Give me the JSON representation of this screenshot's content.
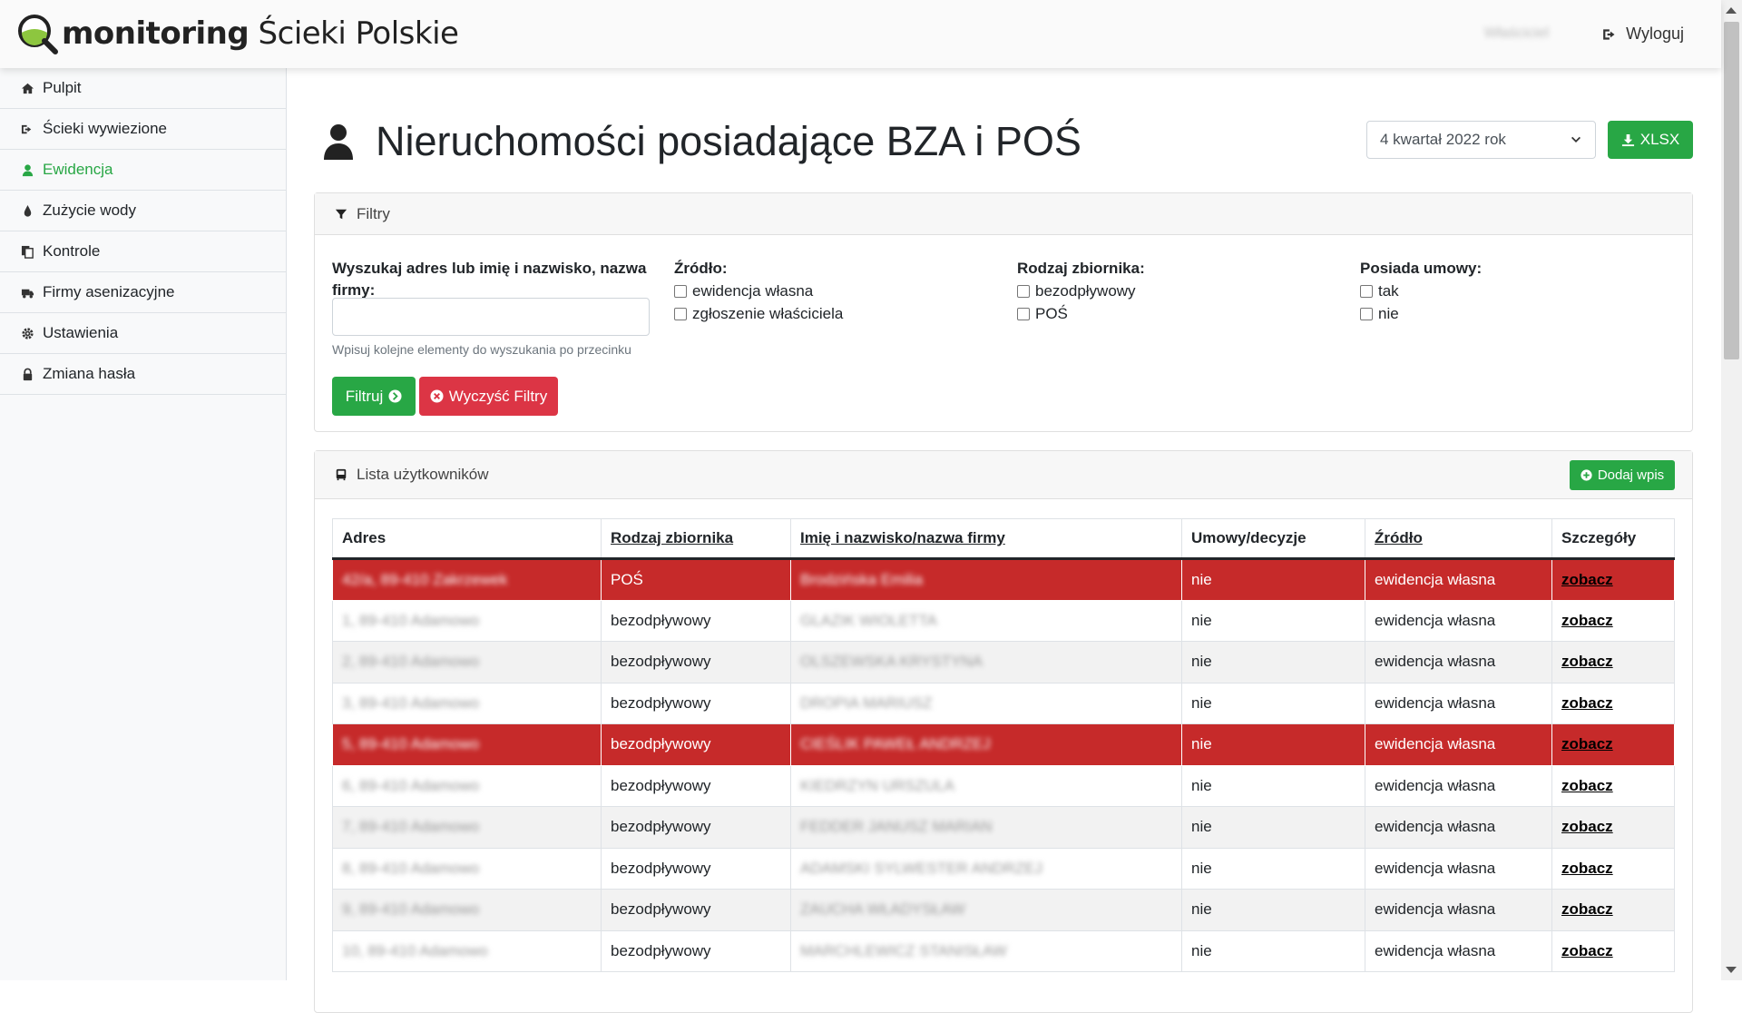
{
  "app": {
    "logo_bold": "monitoring",
    "logo_rest": " Ścieki Polskie",
    "user": "Właściciel",
    "logout": "Wyloguj"
  },
  "sidebar": {
    "items": [
      {
        "label": "Pulpit",
        "icon": "home-icon"
      },
      {
        "label": "Ścieki wywiezione",
        "icon": "sign-out-icon"
      },
      {
        "label": "Ewidencja",
        "icon": "user-icon",
        "active": true
      },
      {
        "label": "Zużycie wody",
        "icon": "water-drop-icon"
      },
      {
        "label": "Kontrole",
        "icon": "documents-icon"
      },
      {
        "label": "Firmy asenizacyjne",
        "icon": "truck-icon"
      },
      {
        "label": "Ustawienia",
        "icon": "gear-icon"
      },
      {
        "label": "Zmiana hasła",
        "icon": "lock-icon"
      }
    ]
  },
  "header": {
    "title": "Nieruchomości posiadające BZA i POŚ",
    "quarter": "4 kwartał 2022 rok",
    "export": "XLSX"
  },
  "filters": {
    "title": "Filtry",
    "search_label": "Wyszukaj adres lub imię i nazwisko, nazwa firmy:",
    "search_value": "",
    "search_hint": "Wpisuj kolejne elementy do wyszukania po przecinku",
    "source": {
      "label": "Źródło:",
      "options": [
        "ewidencja własna",
        "zgłoszenie właściciela"
      ]
    },
    "tank": {
      "label": "Rodzaj zbiornika:",
      "options": [
        "bezodpływowy",
        "POŚ"
      ]
    },
    "contract": {
      "label": "Posiada umowy:",
      "options": [
        "tak",
        "nie"
      ]
    },
    "filter_button": "Filtruj",
    "clear_button": "Wyczyść Filtry"
  },
  "list": {
    "title": "Lista użytkowników",
    "add_button": "Dodaj wpis",
    "columns": [
      "Adres",
      "Rodzaj zbiornika",
      "Imię i nazwisko/nazwa firmy",
      "Umowy/decyzje",
      "Źródło",
      "Szczegóły"
    ],
    "rows": [
      {
        "address": "42/a, 89-410 Zakrzewek",
        "tank": "POŚ",
        "name": "Brodzińska Emilia",
        "contracts": "nie",
        "source": "ewidencja własna",
        "details": "zobacz",
        "highlight": true
      },
      {
        "address": "1, 89-410 Adamowo",
        "tank": "bezodpływowy",
        "name": "GLAZIK WIOLETTA",
        "contracts": "nie",
        "source": "ewidencja własna",
        "details": "zobacz",
        "highlight": false
      },
      {
        "address": "2, 89-410 Adamowo",
        "tank": "bezodpływowy",
        "name": "OLSZEWSKA KRYSTYNA",
        "contracts": "nie",
        "source": "ewidencja własna",
        "details": "zobacz",
        "highlight": false
      },
      {
        "address": "3, 89-410 Adamowo",
        "tank": "bezodpływowy",
        "name": "DROPIA MARIUSZ",
        "contracts": "nie",
        "source": "ewidencja własna",
        "details": "zobacz",
        "highlight": false
      },
      {
        "address": "5, 89-410 Adamowo",
        "tank": "bezodpływowy",
        "name": "CIEŚLIK PAWEŁ ANDRZEJ",
        "contracts": "nie",
        "source": "ewidencja własna",
        "details": "zobacz",
        "highlight": true
      },
      {
        "address": "6, 89-410 Adamowo",
        "tank": "bezodpływowy",
        "name": "KIEDRZYN URSZULA",
        "contracts": "nie",
        "source": "ewidencja własna",
        "details": "zobacz",
        "highlight": false
      },
      {
        "address": "7, 89-410 Adamowo",
        "tank": "bezodpływowy",
        "name": "FEDDER JANUSZ MARIAN",
        "contracts": "nie",
        "source": "ewidencja własna",
        "details": "zobacz",
        "highlight": false
      },
      {
        "address": "8, 89-410 Adamowo",
        "tank": "bezodpływowy",
        "name": "ADAMSKI SYLWESTER ANDRZEJ",
        "contracts": "nie",
        "source": "ewidencja własna",
        "details": "zobacz",
        "highlight": false
      },
      {
        "address": "9, 89-410 Adamowo",
        "tank": "bezodpływowy",
        "name": "ZAUCHA WŁADYSŁAW",
        "contracts": "nie",
        "source": "ewidencja własna",
        "details": "zobacz",
        "highlight": false
      },
      {
        "address": "10, 89-410 Adamowo",
        "tank": "bezodpływowy",
        "name": "MARCHLEWICZ STANISŁAW",
        "contracts": "nie",
        "source": "ewidencja własna",
        "details": "zobacz",
        "highlight": false
      }
    ]
  },
  "colors": {
    "accent": "#28a745",
    "danger": "#dc3545",
    "highlight_row": "#c62a2a"
  }
}
